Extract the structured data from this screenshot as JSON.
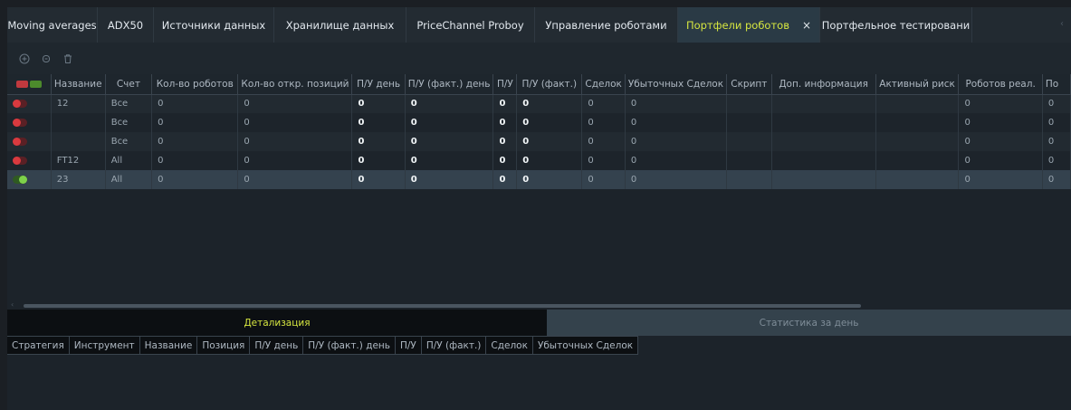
{
  "tabs": [
    {
      "label": "Moving averages"
    },
    {
      "label": "ADX50"
    },
    {
      "label": "Источники данных"
    },
    {
      "label": "Хранилище данных"
    },
    {
      "label": "PriceChannel Proboy"
    },
    {
      "label": "Управление роботами"
    },
    {
      "label": "Портфели роботов",
      "active": true,
      "close": "×"
    },
    {
      "label": "Портфельное тестировани"
    }
  ],
  "toolbar": {
    "icons": [
      "add-icon",
      "copy-icon",
      "delete-icon"
    ]
  },
  "grid": {
    "headers": [
      "Название",
      "Счет",
      "Кол-во роботов",
      "Кол-во откр. позиций",
      "П/У день",
      "П/У (факт.) день",
      "П/У",
      "П/У (факт.)",
      "Сделок",
      "Убыточных Сделок",
      "Скрипт",
      "Доп. информация",
      "Активный риск",
      "Роботов реал.",
      "По"
    ],
    "rows": [
      {
        "toggle": "off",
        "name": "12",
        "account": "Все",
        "robots": "0",
        "open_positions": "0",
        "pnl_day": "0",
        "pnl_fact_day": "0",
        "pnl": "0",
        "pnl_fact": "0",
        "deals": "0",
        "losing_deals": "0",
        "script": "",
        "info": "",
        "risk": "",
        "robots_real": "0",
        "po": "0"
      },
      {
        "toggle": "off",
        "name": "",
        "account": "Все",
        "robots": "0",
        "open_positions": "0",
        "pnl_day": "0",
        "pnl_fact_day": "0",
        "pnl": "0",
        "pnl_fact": "0",
        "deals": "0",
        "losing_deals": "0",
        "script": "",
        "info": "",
        "risk": "",
        "robots_real": "0",
        "po": "0"
      },
      {
        "toggle": "off",
        "name": "",
        "account": "Все",
        "robots": "0",
        "open_positions": "0",
        "pnl_day": "0",
        "pnl_fact_day": "0",
        "pnl": "0",
        "pnl_fact": "0",
        "deals": "0",
        "losing_deals": "0",
        "script": "",
        "info": "",
        "risk": "",
        "robots_real": "0",
        "po": "0"
      },
      {
        "toggle": "off",
        "name": "FT12",
        "account": "All",
        "robots": "0",
        "open_positions": "0",
        "pnl_day": "0",
        "pnl_fact_day": "0",
        "pnl": "0",
        "pnl_fact": "0",
        "deals": "0",
        "losing_deals": "0",
        "script": "",
        "info": "",
        "risk": "",
        "robots_real": "0",
        "po": "0"
      },
      {
        "toggle": "on",
        "name": "23",
        "account": "All",
        "robots": "0",
        "open_positions": "0",
        "pnl_day": "0",
        "pnl_fact_day": "0",
        "pnl": "0",
        "pnl_fact": "0",
        "deals": "0",
        "losing_deals": "0",
        "script": "",
        "info": "",
        "risk": "",
        "robots_real": "0",
        "po": "0",
        "selected": true
      }
    ]
  },
  "detail": {
    "tabs": [
      {
        "label": "Детализация",
        "active": true
      },
      {
        "label": "Статистика за день"
      }
    ],
    "headers": [
      "Стратегия",
      "Инструмент",
      "Название",
      "Позиция",
      "П/У день",
      "П/У (факт.) день",
      "П/У",
      "П/У (факт.)",
      "Сделок",
      "Убыточных Сделок"
    ]
  },
  "colors": {
    "accent": "#d6e640",
    "toggle_off": "#d93a3f",
    "toggle_on": "#7ed14a",
    "badge_off": "#c0393e",
    "badge_on": "#4c8a2c"
  }
}
